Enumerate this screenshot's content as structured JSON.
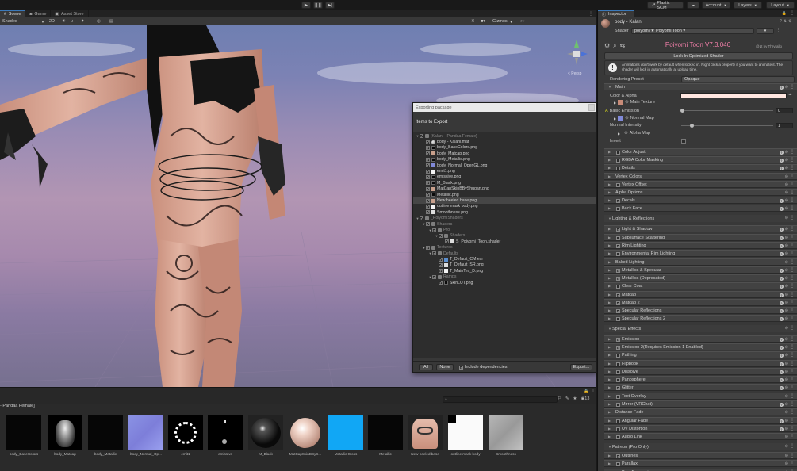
{
  "topbar": {
    "play": "▶",
    "pause": "❚❚",
    "step": "▶|",
    "plastic_scm": "Plastic SCM",
    "cloud_icon": "cloud-icon",
    "account": "Account",
    "layers": "Layers",
    "layout": "Layout"
  },
  "scene": {
    "tabs": [
      {
        "label": "Scene",
        "icon": "hash-icon"
      },
      {
        "label": "Game",
        "icon": "gamepad-icon"
      },
      {
        "label": "Asset Store",
        "icon": "store-icon"
      }
    ],
    "shading_mode": "Shaded",
    "mode_2d": "2D",
    "gizmos": "Gizmos",
    "view_label": "< Persp"
  },
  "export_dialog": {
    "title": "Exporting package",
    "header": "Items to Export",
    "tree": [
      {
        "label": "[Kalani - Pandaa Female]",
        "indent": 0,
        "icon": "folder",
        "twisty": "▼",
        "checked": true,
        "dim": true
      },
      {
        "label": "body - Kalani.mat",
        "indent": 1,
        "icon": "sphere",
        "checked": true
      },
      {
        "label": "body_BaseColors.png",
        "indent": 1,
        "icon": "dark",
        "checked": true
      },
      {
        "label": "body_Matcap.png",
        "indent": 1,
        "icon": "skin",
        "checked": true
      },
      {
        "label": "body_Metallic.png",
        "indent": 1,
        "icon": "dark",
        "checked": true
      },
      {
        "label": "body_Normal_OpenGL.png",
        "indent": 1,
        "icon": "blue",
        "checked": true
      },
      {
        "label": "emit1.png",
        "indent": 1,
        "icon": "white",
        "checked": true
      },
      {
        "label": "emissive.png",
        "indent": 1,
        "icon": "dark",
        "checked": true
      },
      {
        "label": "M_Black.png",
        "indent": 1,
        "icon": "dark",
        "checked": true
      },
      {
        "label": "MatCapSkinBByShugan.png",
        "indent": 1,
        "icon": "skin",
        "checked": true
      },
      {
        "label": "Metallic.png",
        "indent": 1,
        "icon": "dark",
        "checked": true
      },
      {
        "label": "New heeled base.png",
        "indent": 1,
        "icon": "skin",
        "checked": true,
        "selected": true
      },
      {
        "label": "outline mask body.png",
        "indent": 1,
        "icon": "white",
        "checked": true
      },
      {
        "label": "Smoothness.png",
        "indent": 1,
        "icon": "file",
        "checked": true
      },
      {
        "label": "_PoiyomiShaders",
        "indent": 0,
        "icon": "folder",
        "twisty": "▼",
        "checked": true,
        "dim": true
      },
      {
        "label": "Shaders",
        "indent": 1,
        "icon": "folder",
        "twisty": "▼",
        "checked": true,
        "dim": true
      },
      {
        "label": "Pro",
        "indent": 2,
        "icon": "folder",
        "twisty": "▼",
        "checked": true,
        "dim": true
      },
      {
        "label": "Shaders",
        "indent": 3,
        "icon": "folder",
        "twisty": "▼",
        "checked": true,
        "dim": true
      },
      {
        "label": "S_Poiyomi_Toon.shader",
        "indent": 4,
        "icon": "file",
        "checked": true
      },
      {
        "label": "Textures",
        "indent": 1,
        "icon": "folder",
        "twisty": "▼",
        "checked": true,
        "dim": true
      },
      {
        "label": "Defaults",
        "indent": 2,
        "icon": "folder",
        "twisty": "▼",
        "checked": true,
        "dim": true
      },
      {
        "label": "T_Default_CM.exr",
        "indent": 3,
        "icon": "star",
        "checked": true
      },
      {
        "label": "T_Default_SR.png",
        "indent": 3,
        "icon": "file",
        "checked": true
      },
      {
        "label": "T_MainTex_D.png",
        "indent": 3,
        "icon": "white",
        "checked": true
      },
      {
        "label": "Ramps",
        "indent": 2,
        "icon": "folder",
        "twisty": "▼",
        "checked": true,
        "dim": true
      },
      {
        "label": "SkinLUT.png",
        "indent": 3,
        "icon": "dark",
        "checked": true
      }
    ],
    "btn_all": "All",
    "btn_none": "None",
    "include_dependencies": "Include dependencies",
    "btn_export": "Export..."
  },
  "project": {
    "breadcrumb": "- Pandaa Female]",
    "search_placeholder": "",
    "assets": [
      {
        "label": "body_BaseColors",
        "thumb": "black"
      },
      {
        "label": "body_Matcap",
        "thumb": "matcap"
      },
      {
        "label": "body_Metallic",
        "thumb": "black"
      },
      {
        "label": "body_Normal_Op...",
        "thumb": "normal"
      },
      {
        "label": "emit1",
        "thumb": "ring"
      },
      {
        "label": "emissive",
        "thumb": "emissive"
      },
      {
        "label": "M_Black",
        "thumb": "sphere-dark"
      },
      {
        "label": "MatCapSkinBByS...",
        "thumb": "sphere-skin"
      },
      {
        "label": "Metallic Gloss",
        "thumb": "cyan"
      },
      {
        "label": "Metallic",
        "thumb": "black"
      },
      {
        "label": "New heeled base",
        "thumb": "skin"
      },
      {
        "label": "outline mask body",
        "thumb": "white"
      },
      {
        "label": "Smoothness",
        "thumb": "gray"
      }
    ]
  },
  "inspector": {
    "tab": "Inspector",
    "object_name": "body - Kalani",
    "shader_label": "Shader",
    "shader_value": "poiyomi/★ Poiyomi Toon ▾",
    "poiyomi_title": "Poiyomi Toon V7.3.046",
    "by_label": "@Lt by Thryrallo",
    "lock_button": "Lock In Optimized Shader",
    "warning": "Animations don't work by default when locked in. Right click a property if you want to animate it. The shader will lock in automatically at upload time.",
    "rendering_preset_label": "Rendering Preset",
    "rendering_preset_value": "Opaque",
    "main": {
      "header": "Main",
      "color_alpha": "Color & Alpha",
      "main_texture": "Main Texture",
      "basic_emission": "Basic Emission",
      "emission_value": "0",
      "normal_map": "Normal Map",
      "normal_intensity": "Normal Intensity",
      "normal_intensity_value": "1",
      "alpha_map": "Alpha Map",
      "invert": "Invert"
    },
    "sections": [
      {
        "label": "Color Adjust",
        "checkbox": true,
        "checked": false,
        "help": true
      },
      {
        "label": "RGBA Color Masking",
        "checkbox": true,
        "checked": false,
        "help": true
      },
      {
        "label": "Details",
        "checkbox": true,
        "checked": false,
        "help": true
      },
      {
        "label": "Vertex Colors",
        "checkbox": false,
        "help": false
      },
      {
        "label": "Vertex Offset",
        "checkbox": true,
        "checked": false,
        "help": false
      },
      {
        "label": "Alpha Options",
        "checkbox": false,
        "help": false
      },
      {
        "label": "Decals",
        "checkbox": true,
        "checked": true,
        "help": true
      },
      {
        "label": "Back Face",
        "checkbox": true,
        "checked": false,
        "help": true
      },
      {
        "label": "Lighting & Reflections",
        "header": true
      },
      {
        "label": "Light & Shadow",
        "checkbox": true,
        "checked": true,
        "help": true
      },
      {
        "label": "Subsurface Scattering",
        "checkbox": true,
        "checked": false,
        "help": true
      },
      {
        "label": "Rim Lighting",
        "checkbox": true,
        "checked": true,
        "help": true
      },
      {
        "label": "Environmental Rim Lighting",
        "checkbox": true,
        "checked": false,
        "help": true
      },
      {
        "label": "Baked Lighting",
        "checkbox": false,
        "help": false
      },
      {
        "label": "Metallics & Specular",
        "checkbox": true,
        "checked": true,
        "help": true
      },
      {
        "label": "Metallics (Deprecated)",
        "checkbox": true,
        "checked": true,
        "help": true
      },
      {
        "label": "Clear Coat",
        "checkbox": true,
        "checked": false,
        "help": true
      },
      {
        "label": "Matcap",
        "checkbox": true,
        "checked": true,
        "help": true
      },
      {
        "label": "Matcap 2",
        "checkbox": true,
        "checked": true,
        "help": true
      },
      {
        "label": "Specular Reflections",
        "checkbox": true,
        "checked": true,
        "help": true
      },
      {
        "label": "Specular Reflections 2",
        "checkbox": true,
        "checked": false,
        "help": true
      },
      {
        "label": "Special Effects",
        "header": true
      },
      {
        "label": "Emission",
        "checkbox": true,
        "checked": true,
        "help": true
      },
      {
        "label": "Emission 2(Requires Emission 1 Enabled)",
        "checkbox": true,
        "checked": true,
        "help": true
      },
      {
        "label": "Pathing",
        "checkbox": true,
        "checked": false,
        "help": true
      },
      {
        "label": "Flipbook",
        "checkbox": true,
        "checked": false,
        "help": true
      },
      {
        "label": "Dissolve",
        "checkbox": true,
        "checked": false,
        "help": true
      },
      {
        "label": "Panosphere",
        "checkbox": true,
        "checked": false,
        "help": true
      },
      {
        "label": "Glitter",
        "checkbox": true,
        "checked": true,
        "help": true
      },
      {
        "label": "Text Overlay",
        "checkbox": true,
        "checked": false,
        "help": false
      },
      {
        "label": "Mirror (VRChat)",
        "checkbox": true,
        "checked": false,
        "help": true
      },
      {
        "label": "Distance Fade",
        "checkbox": false,
        "help": false
      },
      {
        "label": "Angular Fade",
        "checkbox": true,
        "checked": false,
        "help": true
      },
      {
        "label": "UV Distortion",
        "checkbox": true,
        "checked": false,
        "help": true
      },
      {
        "label": "Audio Link",
        "checkbox": true,
        "checked": false,
        "help": false
      },
      {
        "label": "Patreon (Pro Only)",
        "header": true
      },
      {
        "label": "Outlines",
        "checkbox": true,
        "checked": true,
        "help": false
      },
      {
        "label": "Parallax",
        "checkbox": true,
        "checked": false,
        "help": false
      },
      {
        "label": "Post Processing",
        "checkbox": true,
        "checked": false,
        "help": false
      }
    ]
  },
  "colors": {
    "accent_blue": "#3a79bb",
    "poiyomi_pink": "#f07ea8",
    "panel": "#383838",
    "skin": "#d9a795"
  }
}
